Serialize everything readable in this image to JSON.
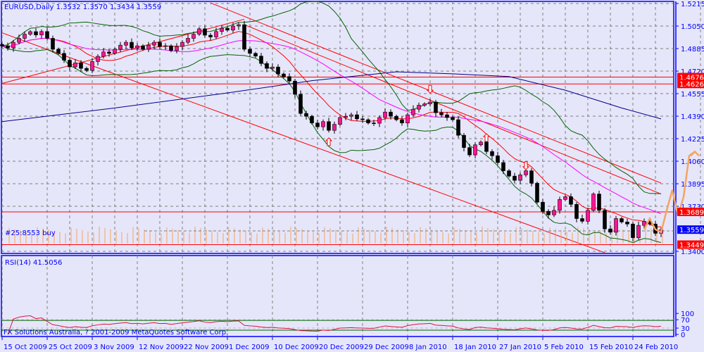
{
  "chart_data": {
    "type": "candlestick",
    "title": "EURUSD,Daily",
    "ohlc_header": [
      "1.3532",
      "1.3570",
      "1.3434",
      "1.3559"
    ],
    "trade_label": "#25:8553 buy",
    "copyright": "FX Solutions Australia, ? 2001-2009 MetaQuotes Software Corp.",
    "price_ylim": [
      1.3375,
      1.523
    ],
    "price_ticks": [
      "1.5215",
      "1.5050",
      "1.4885",
      "1.4720",
      "1.4555",
      "1.4390",
      "1.4225",
      "1.4060",
      "1.3895",
      "1.3730",
      "1.3400"
    ],
    "price_labels": [
      {
        "value": "1.4676",
        "color": "#ff0000"
      },
      {
        "value": "1.4626",
        "color": "#ff0000"
      },
      {
        "value": "1.3689",
        "color": "#ff0000"
      },
      {
        "value": "1.3559",
        "color": "#0000ff"
      },
      {
        "value": "1.3449",
        "color": "#ff0000"
      }
    ],
    "horizontal_lines": [
      1.4676,
      1.4626,
      1.3689,
      1.3449
    ],
    "date_ticks": [
      {
        "bar": 0,
        "label": "15 Oct 2009"
      },
      {
        "bar": 8,
        "label": "25 Oct 2009"
      },
      {
        "bar": 16,
        "label": "3 Nov 2009"
      },
      {
        "bar": 24,
        "label": "12 Nov 2009"
      },
      {
        "bar": 32,
        "label": "22 Nov 2009"
      },
      {
        "bar": 40,
        "label": "1 Dec 2009"
      },
      {
        "bar": 48,
        "label": "10 Dec 2009"
      },
      {
        "bar": 56,
        "label": "20 Dec 2009"
      },
      {
        "bar": 64,
        "label": "29 Dec 2009"
      },
      {
        "bar": 72,
        "label": "8 Jan 2010"
      },
      {
        "bar": 80,
        "label": "18 Jan 2010"
      },
      {
        "bar": 88,
        "label": "27 Jan 2010"
      },
      {
        "bar": 96,
        "label": "5 Feb 2010"
      },
      {
        "bar": 104,
        "label": "15 Feb 2010"
      },
      {
        "bar": 112,
        "label": "24 Feb 2010"
      }
    ],
    "closes": [
      1.4905,
      1.489,
      1.4931,
      1.496,
      1.499,
      1.5009,
      1.4985,
      1.501,
      1.496,
      1.488,
      1.485,
      1.48,
      1.4751,
      1.478,
      1.474,
      1.4725,
      1.479,
      1.4828,
      1.486,
      1.485,
      1.488,
      1.491,
      1.4931,
      1.489,
      1.4905,
      1.488,
      1.491,
      1.4931,
      1.49,
      1.4905,
      1.487,
      1.49,
      1.4931,
      1.496,
      1.499,
      1.503,
      1.4983,
      1.497,
      1.501,
      1.5034,
      1.502,
      1.505,
      1.506,
      1.488,
      1.485,
      1.483,
      1.4776,
      1.474,
      1.475,
      1.4699,
      1.468,
      1.4647,
      1.455,
      1.441,
      1.4389,
      1.434,
      1.4312,
      1.435,
      1.4286,
      1.433,
      1.438,
      1.4389,
      1.44,
      1.437,
      1.4364,
      1.434,
      1.4338,
      1.438,
      1.442,
      1.4389,
      1.4364,
      1.434,
      1.44,
      1.4441,
      1.447,
      1.448,
      1.4493,
      1.4415,
      1.44,
      1.438,
      1.4364,
      1.425,
      1.416,
      1.4106,
      1.418,
      1.42,
      1.4131,
      1.41,
      1.405,
      1.399,
      1.3951,
      1.392,
      1.396,
      1.399,
      1.3899,
      1.376,
      1.3693,
      1.3667,
      1.37,
      1.378,
      1.38,
      1.3744,
      1.364,
      1.362,
      1.37,
      1.382,
      1.37,
      1.3564,
      1.354,
      1.364,
      1.3615,
      1.36,
      1.35,
      1.359,
      1.362,
      1.36,
      1.3532,
      1.3559
    ],
    "long_ma": [
      [
        0,
        1.435
      ],
      [
        20,
        1.445
      ],
      [
        40,
        1.456
      ],
      [
        55,
        1.465
      ],
      [
        70,
        1.4715
      ],
      [
        80,
        1.47
      ],
      [
        90,
        1.468
      ],
      [
        100,
        1.458
      ],
      [
        110,
        1.445
      ],
      [
        117,
        1.437
      ]
    ],
    "trendlines": [
      [
        [
          0,
          1.5
        ],
        [
          107,
          1.339
        ]
      ],
      [
        [
          0,
          1.463
        ],
        [
          43,
          1.51
        ]
      ],
      [
        [
          37,
          1.522
        ],
        [
          117,
          1.39
        ]
      ],
      [
        [
          43,
          1.506
        ],
        [
          117,
          1.382
        ]
      ]
    ],
    "forecast": [
      [
        114,
        1.356
      ],
      [
        115,
        1.364
      ],
      [
        116,
        1.356
      ],
      [
        117,
        1.354
      ],
      [
        118,
        1.37
      ],
      [
        119,
        1.385
      ],
      [
        120,
        1.366
      ],
      [
        121,
        1.38
      ],
      [
        122,
        1.41
      ],
      [
        123,
        1.413
      ]
    ],
    "arrows": [
      {
        "bar": 58,
        "price": 1.42,
        "dir": "up"
      },
      {
        "bar": 76,
        "price": 1.459,
        "dir": "down"
      },
      {
        "bar": 86,
        "price": 1.423,
        "dir": "up"
      },
      {
        "bar": 93,
        "price": 1.403,
        "dir": "down"
      }
    ],
    "rsi": {
      "label": "RSI(14) 41.5056",
      "period": 14,
      "ylim": [
        0,
        100
      ],
      "ticks": [
        "100",
        "70",
        "30",
        "0"
      ],
      "levels": [
        70,
        30
      ]
    },
    "colors": {
      "bull": "#ff1493",
      "bear": "#000000",
      "grid": "#808080",
      "axis": "#0000ff",
      "bands": "#006400",
      "fast_ma": "#ff0000",
      "mid_ma": "#ff00ff",
      "long_ma": "#00008b",
      "forecast": "#f4a460",
      "rsi": "#dc143c"
    }
  }
}
